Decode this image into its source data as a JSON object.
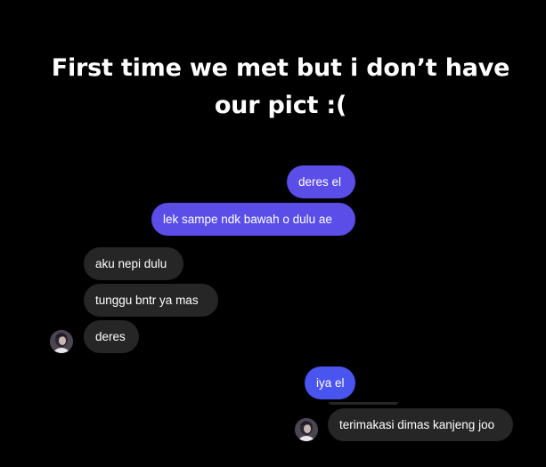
{
  "caption": {
    "line1": "First time we met but i don’t have",
    "line2": "our pict :("
  },
  "messages": [
    {
      "id": "m1",
      "side": "outgoing",
      "text": "deres el"
    },
    {
      "id": "m2",
      "side": "outgoing",
      "text": "lek sampe ndk bawah o dulu ae"
    },
    {
      "id": "m3",
      "side": "incoming",
      "text": "aku nepi dulu"
    },
    {
      "id": "m4",
      "side": "incoming",
      "text": "tunggu bntr ya mas"
    },
    {
      "id": "m5",
      "side": "incoming",
      "text": "deres"
    },
    {
      "id": "m6",
      "side": "outgoing",
      "text": "iya el"
    },
    {
      "id": "m7",
      "side": "incoming",
      "text": "terimakasi dimas kanjeng joo"
    }
  ],
  "colors": {
    "background": "#000000",
    "outgoing_bubble": "#5b4de8",
    "outgoing_bubble_blue": "#4a55f0",
    "incoming_bubble": "#262626",
    "text": "#ffffff"
  },
  "icons": {
    "avatar": "contact-avatar-icon"
  }
}
